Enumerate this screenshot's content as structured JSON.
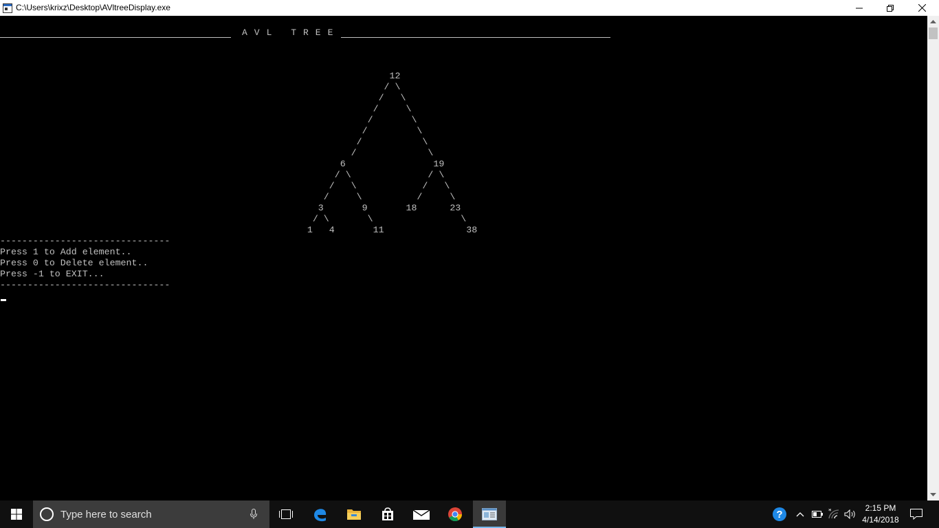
{
  "window": {
    "title": "C:\\Users\\krixz\\Desktop\\AVltreeDisplay.exe",
    "icon": "console-app-icon",
    "controls": [
      "minimize-icon",
      "restore-icon",
      "close-icon"
    ]
  },
  "console": {
    "header_title": "AVL TREE",
    "tree_lines": [
      "",
      "",
      "",
      "",
      "",
      "                                                                       12",
      "                                                                      / \\",
      "                                                                     /   \\",
      "                                                                    /     \\",
      "                                                                   /       \\",
      "                                                                  /         \\",
      "                                                                 /           \\",
      "                                                                /             \\",
      "                                                              6                19",
      "                                                             / \\              / \\",
      "                                                            /   \\            /   \\",
      "                                                           /     \\          /     \\",
      "                                                          3       9       18      23",
      "                                                         / \\       \\                \\",
      "                                                        1   4       11               38"
    ],
    "menu_lines": [
      "-------------------------------",
      "Press 1 to Add element..",
      "Press 0 to Delete element..",
      "Press -1 to EXIT...",
      "-------------------------------"
    ],
    "text_color": "#c0c0c0",
    "background": "#000000"
  },
  "taskbar": {
    "search_placeholder": "Type here to search",
    "pinned": [
      "windows-start-icon",
      "task-view-icon",
      "edge-icon",
      "file-explorer-icon",
      "store-icon",
      "mail-icon",
      "chrome-icon",
      "console-window-icon"
    ],
    "clock_time": "2:15 PM",
    "clock_date": "4/14/2018",
    "accent": "#76b9ed"
  }
}
